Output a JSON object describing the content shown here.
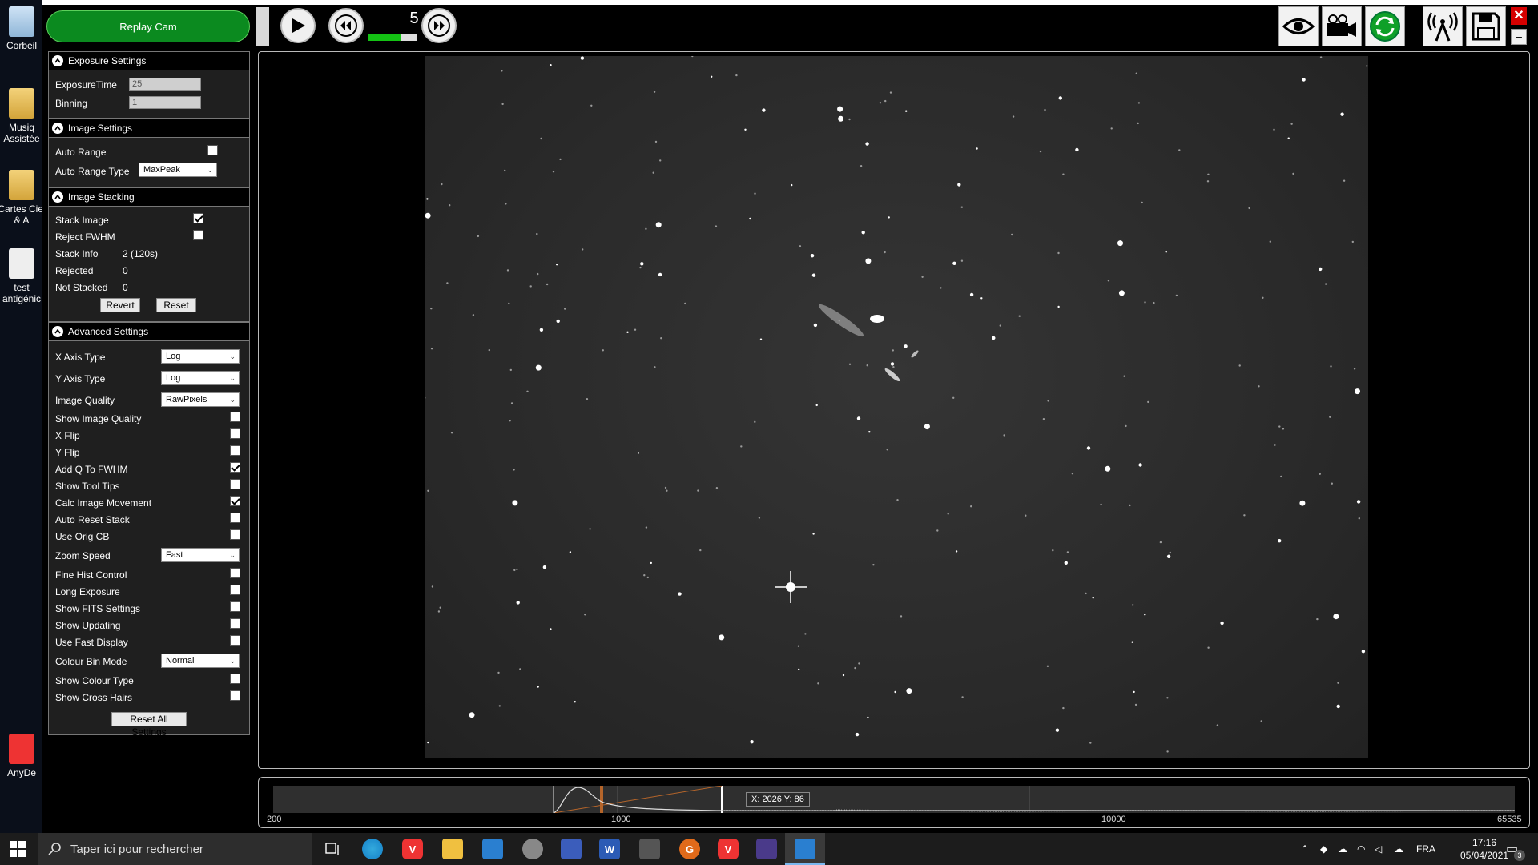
{
  "desktop": {
    "icons": [
      {
        "label": "Corbeil"
      },
      {
        "label": "Musiq Assistée"
      },
      {
        "label": "Cartes Ciel & A"
      },
      {
        "label": "test antigénic"
      },
      {
        "label": "AnyDe"
      }
    ]
  },
  "toolbar": {
    "replay_label": "Replay Cam",
    "frame_number": "5",
    "frame_progress": 0.68,
    "icons": [
      "play-icon",
      "rewind-icon",
      "fast-forward-icon",
      "eye-icon",
      "camera-icon",
      "refresh-icon",
      "antenna-icon",
      "save-icon",
      "close-icon",
      "minimize-icon"
    ]
  },
  "exposure": {
    "title": "Exposure Settings",
    "exposure_time_label": "ExposureTime",
    "exposure_time_value": "25",
    "binning_label": "Binning",
    "binning_value": "1"
  },
  "image_settings": {
    "title": "Image Settings",
    "auto_range_label": "Auto Range",
    "auto_range_checked": false,
    "auto_range_type_label": "Auto Range Type",
    "auto_range_type_value": "MaxPeak"
  },
  "stacking": {
    "title": "Image Stacking",
    "stack_image_label": "Stack Image",
    "stack_image_checked": true,
    "reject_fwhm_label": "Reject FWHM",
    "reject_fwhm_checked": false,
    "stack_info_label": "Stack Info",
    "stack_info_value": "2 (120s)",
    "rejected_label": "Rejected",
    "rejected_value": "0",
    "not_stacked_label": "Not Stacked",
    "not_stacked_value": "0",
    "revert_label": "Revert",
    "reset_label": "Reset"
  },
  "advanced": {
    "title": "Advanced Settings",
    "x_axis_label": "X Axis Type",
    "x_axis_value": "Log",
    "y_axis_label": "Y Axis Type",
    "y_axis_value": "Log",
    "quality_label": "Image Quality",
    "quality_value": "RawPixels",
    "checkboxes": [
      {
        "label": "Show Image Quality",
        "checked": false
      },
      {
        "label": "X Flip",
        "checked": false
      },
      {
        "label": "Y Flip",
        "checked": false
      },
      {
        "label": "Add Q To FWHM",
        "checked": true
      },
      {
        "label": "Show Tool Tips",
        "checked": false
      },
      {
        "label": "Calc Image Movement",
        "checked": true
      },
      {
        "label": "Auto Reset Stack",
        "checked": false
      },
      {
        "label": "Use Orig CB",
        "checked": false
      }
    ],
    "zoom_speed_label": "Zoom Speed",
    "zoom_speed_value": "Fast",
    "checkboxes2": [
      {
        "label": "Fine Hist Control",
        "checked": false
      },
      {
        "label": "Long Exposure",
        "checked": false
      },
      {
        "label": "Show FITS Settings",
        "checked": false
      },
      {
        "label": "Show Updating",
        "checked": false
      },
      {
        "label": "Use Fast Display",
        "checked": false
      }
    ],
    "colour_bin_label": "Colour Bin Mode",
    "colour_bin_value": "Normal",
    "checkboxes3": [
      {
        "label": "Show Colour Type",
        "checked": false
      },
      {
        "label": "Show Cross Hairs",
        "checked": false
      }
    ],
    "reset_all_label": "Reset All Settings"
  },
  "histogram": {
    "ticks": [
      "200",
      "1000",
      "10000",
      "65535"
    ],
    "coord_readout": "X: 2026 Y: 86"
  },
  "taskbar": {
    "search_placeholder": "Taper ici pour rechercher",
    "lang": "FRA",
    "time": "17:16",
    "date": "05/04/2021",
    "notif_count": "3"
  },
  "colors": {
    "accent_green": "#0b8a1f",
    "close_red": "#d60000"
  }
}
